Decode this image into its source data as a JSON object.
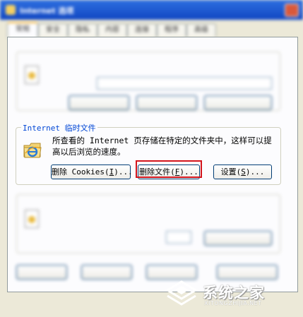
{
  "dialog": {
    "title": "Internet 选项",
    "tabs": [
      "常规",
      "安全",
      "隐私",
      "内容",
      "连接",
      "程序",
      "高级"
    ]
  },
  "temp_files": {
    "legend": "Internet 临时文件",
    "description": "所查看的 Internet 页存储在特定的文件夹中，这样可以提高以后浏览的速度。",
    "delete_cookies": {
      "pre": "删除 Cookies(",
      "key": "I",
      "post": ")..."
    },
    "delete_files": {
      "pre": "删除文件(",
      "key": "F",
      "post": ")..."
    },
    "settings": {
      "pre": "设置(",
      "key": "S",
      "post": ")..."
    }
  },
  "watermark": {
    "text": "系统之家",
    "url": "XITONGZHIJIA.NET"
  },
  "colors": {
    "highlight": "#d3141c",
    "legend_blue": "#0046d5",
    "title_blue": "#1046c2"
  }
}
